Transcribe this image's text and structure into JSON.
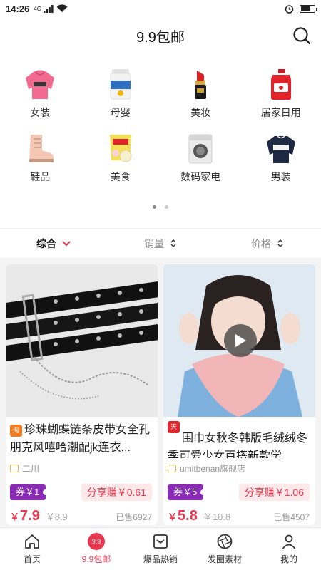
{
  "status": {
    "time": "14:26",
    "network": "4G",
    "battery_level": 0.75
  },
  "header": {
    "title": "9.9包邮"
  },
  "categories": [
    {
      "label": "女装",
      "icon": "hoodie-icon"
    },
    {
      "label": "母婴",
      "icon": "formula-can-icon"
    },
    {
      "label": "美妆",
      "icon": "lipstick-icon"
    },
    {
      "label": "居家日用",
      "icon": "detergent-icon"
    },
    {
      "label": "鞋品",
      "icon": "boot-icon"
    },
    {
      "label": "美食",
      "icon": "snack-bag-icon"
    },
    {
      "label": "数码家电",
      "icon": "washing-machine-icon"
    },
    {
      "label": "男装",
      "icon": "sweater-icon"
    }
  ],
  "pager": {
    "pages": 2,
    "current": 1
  },
  "sort": {
    "comprehensive": "综合",
    "sales": "销量",
    "price": "价格"
  },
  "products": [
    {
      "platform": "淘",
      "platform_color": "#f47b20",
      "title": "珍珠蝴蝶链条皮带女全孔朋克风嘻哈潮配jk连衣...",
      "shop": "二川",
      "coupon": "券￥1",
      "share": "分享赚￥0.61",
      "price": "7.9",
      "original_price": "￥8.9",
      "sold": "已售6927"
    },
    {
      "platform": "天猫",
      "platform_color": "#e0242c",
      "title": "围巾女秋冬韩版毛绒绒冬季可爱少女百搭新款学...",
      "shop": "umitbenan旗舰店",
      "coupon": "券￥5",
      "share": "分享赚￥1.06",
      "price": "5.8",
      "original_price": "￥10.8",
      "sold": "已售4507"
    }
  ],
  "tabbar": [
    {
      "label": "首页",
      "icon": "home-icon"
    },
    {
      "label": "9.9包邮",
      "icon": "nine-nine-icon",
      "badge": "9.9",
      "active": true
    },
    {
      "label": "爆品热销",
      "icon": "hot-sale-icon"
    },
    {
      "label": "发圈素材",
      "icon": "shutter-icon"
    },
    {
      "label": "我的",
      "icon": "user-icon"
    }
  ],
  "colors": {
    "accent": "#e8384f",
    "coupon": "#8a2bb8"
  }
}
